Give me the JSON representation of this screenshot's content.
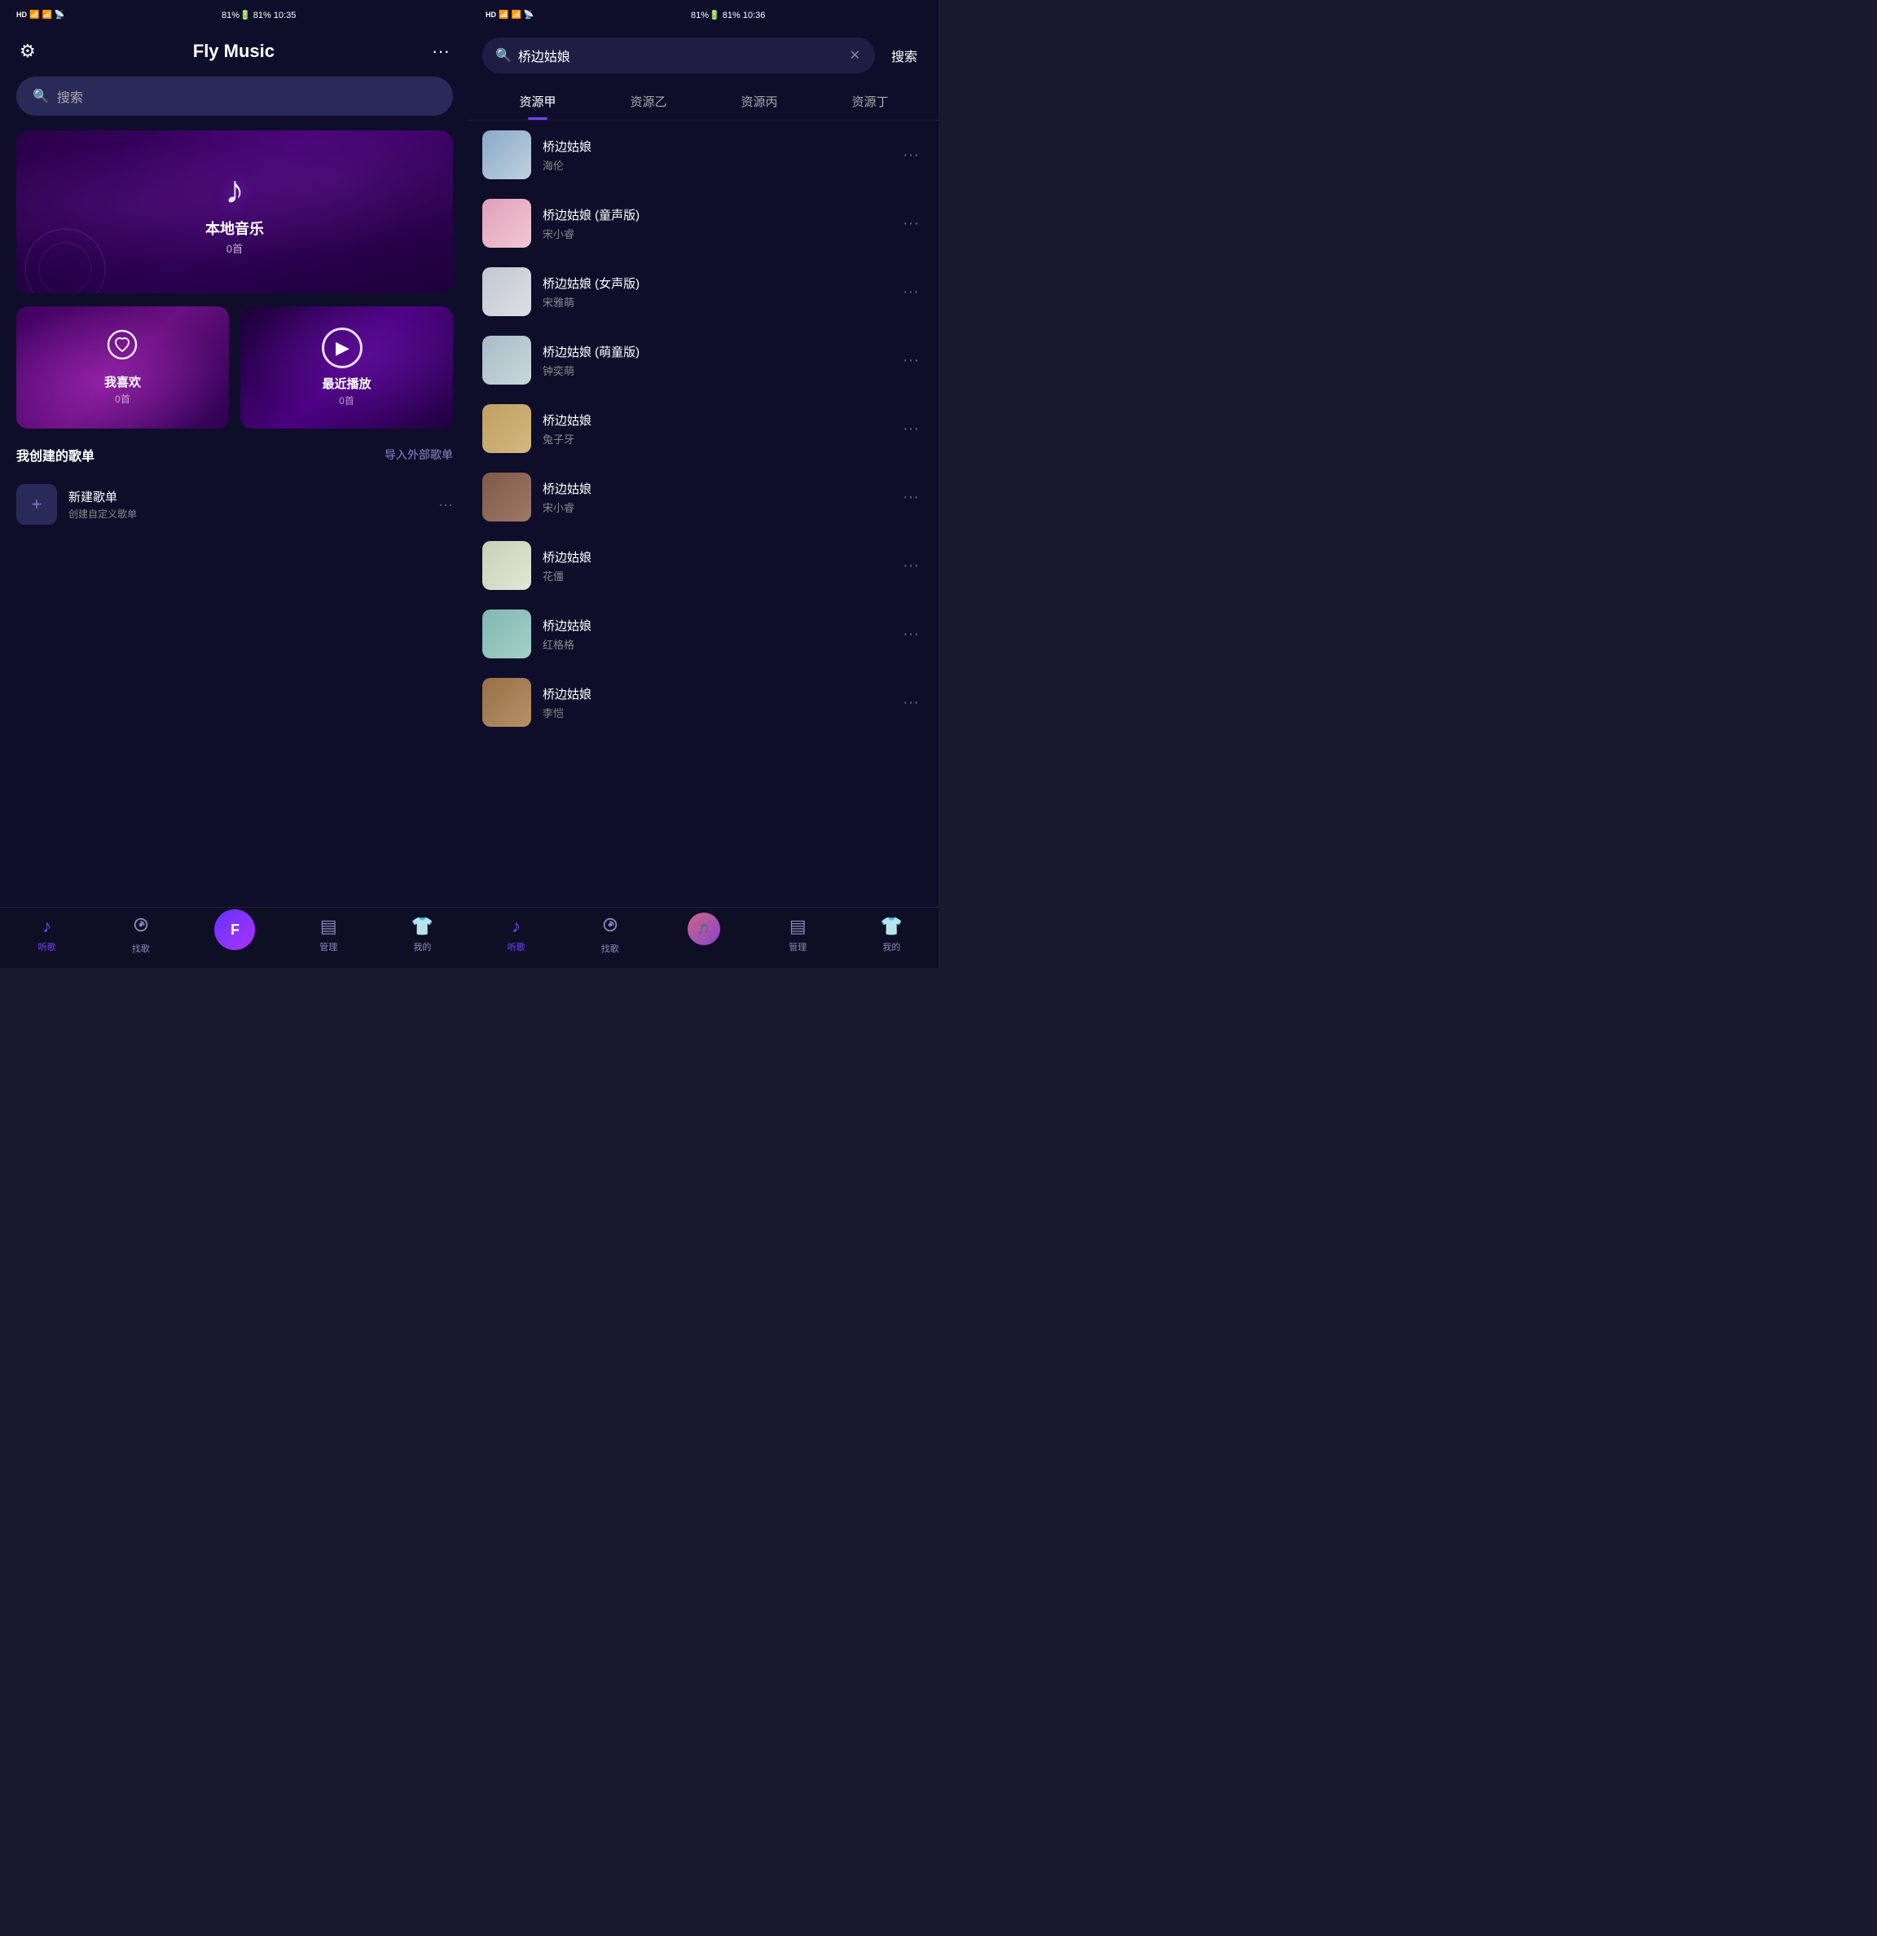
{
  "left": {
    "status": {
      "left": "HD 46 46 ▲",
      "center": "81%  10:35",
      "right": "10:35"
    },
    "title": "Fly Music",
    "settings_icon": "⊹",
    "more_icon": "···",
    "search_placeholder": "搜索",
    "banner": {
      "icon": "♪",
      "title": "本地音乐",
      "count": "0首"
    },
    "cards": [
      {
        "id": "favorites",
        "icon_type": "heart",
        "title": "我喜欢",
        "count": "0首"
      },
      {
        "id": "recent",
        "icon_type": "play",
        "title": "最近播放",
        "count": "0首"
      }
    ],
    "section": {
      "title": "我创建的歌单",
      "action": "导入外部歌单"
    },
    "playlist": {
      "icon": "+",
      "name": "新建歌单",
      "desc": "创建自定义歌单",
      "more": "···"
    },
    "nav": [
      {
        "icon": "♪",
        "label": "听歌",
        "active": true
      },
      {
        "icon": "⊕",
        "label": "找歌",
        "active": false
      },
      {
        "icon": "F",
        "label": "",
        "active": false,
        "center": true
      },
      {
        "icon": "▤",
        "label": "管理",
        "active": false
      },
      {
        "icon": "👕",
        "label": "我的",
        "active": false
      }
    ]
  },
  "right": {
    "status": {
      "left": "HD 46 46 ▲",
      "center": "81%  10:36",
      "right": "10:36"
    },
    "search_value": "桥边姑娘",
    "search_btn": "搜索",
    "tabs": [
      {
        "label": "资源甲",
        "active": true
      },
      {
        "label": "资源乙",
        "active": false
      },
      {
        "label": "资源丙",
        "active": false
      },
      {
        "label": "资源丁",
        "active": false
      }
    ],
    "results": [
      {
        "title": "桥边姑娘",
        "artist": "海伦",
        "thumb_class": "thumb-1",
        "thumb_icon": "🎵"
      },
      {
        "title": "桥边姑娘 (童声版)",
        "artist": "宋小睿",
        "thumb_class": "thumb-2",
        "thumb_icon": "🎵"
      },
      {
        "title": "桥边姑娘 (女声版)",
        "artist": "宋雅萌",
        "thumb_class": "thumb-3",
        "thumb_icon": "🎵"
      },
      {
        "title": "桥边姑娘 (萌童版)",
        "artist": "钟奕萌",
        "thumb_class": "thumb-4",
        "thumb_icon": "🎵"
      },
      {
        "title": "桥边姑娘",
        "artist": "兔子牙",
        "thumb_class": "thumb-5",
        "thumb_icon": "🎵"
      },
      {
        "title": "桥边姑娘",
        "artist": "宋小睿",
        "thumb_class": "thumb-6",
        "thumb_icon": "🎵"
      },
      {
        "title": "桥边姑娘",
        "artist": "花僵",
        "thumb_class": "thumb-7",
        "thumb_icon": "🎵"
      },
      {
        "title": "桥边姑娘",
        "artist": "红格格",
        "thumb_class": "thumb-8",
        "thumb_icon": "🎵"
      },
      {
        "title": "桥边姑娘",
        "artist": "李恺",
        "thumb_class": "thumb-9",
        "thumb_icon": "🎵"
      }
    ],
    "nav": [
      {
        "icon": "♪",
        "label": "听歌",
        "active": true
      },
      {
        "icon": "⊕",
        "label": "找歌",
        "active": false
      },
      {
        "icon": "avatar",
        "label": "",
        "active": false,
        "center": true
      },
      {
        "icon": "▤",
        "label": "管理",
        "active": false
      },
      {
        "icon": "👕",
        "label": "我的",
        "active": false
      }
    ]
  }
}
